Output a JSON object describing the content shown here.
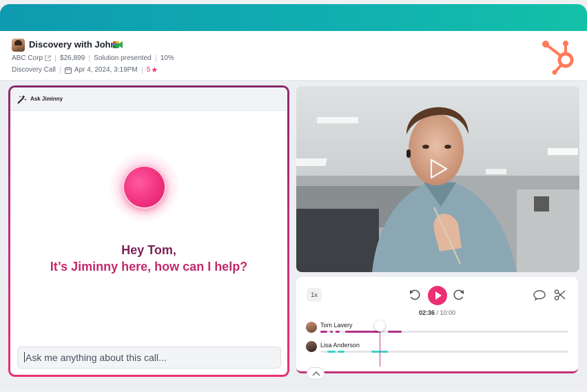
{
  "header": {
    "title": "Discovery with John",
    "company": "ABC Corp",
    "amount": "$26,899",
    "stage": "Solution presented",
    "probability": "10%",
    "call_type": "Discovery Call",
    "date": "Apr 4, 2024, 3:19PM",
    "rating": "5",
    "icons": [
      "avatar",
      "google-meet-icon",
      "external-link-icon",
      "calendar-icon",
      "star-icon",
      "hubspot-logo"
    ]
  },
  "ask": {
    "title": "Ask Jiminny",
    "greeting_line1": "Hey Tom,",
    "greeting_line2": "It’s Jiminny here, how can I help?",
    "input_value": "Ask me anything about this call..."
  },
  "player": {
    "speed": "1x",
    "current_time": "02:36",
    "separator": " / ",
    "total_time": "10:00",
    "speakers": [
      {
        "name": "Tom Lavery",
        "color": "#b4308a"
      },
      {
        "name": "Lisa Anderson",
        "color": "#3fd0c8"
      }
    ]
  },
  "colors": {
    "accent": "#ec2f72",
    "topbar": "#10b0b0",
    "hubspot": "#ff7a59"
  }
}
